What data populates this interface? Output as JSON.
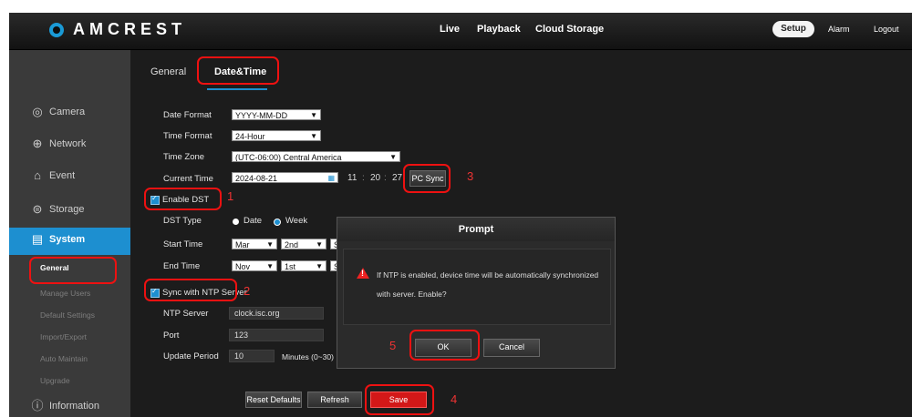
{
  "brand": {
    "name": "AMCREST"
  },
  "topnav": {
    "live": "Live",
    "playback": "Playback",
    "cloud_storage": "Cloud Storage",
    "setup": "Setup",
    "alarm": "Alarm",
    "logout": "Logout"
  },
  "sidebar": {
    "items": [
      {
        "label": "Camera",
        "icon": "camera-icon"
      },
      {
        "label": "Network",
        "icon": "network-icon"
      },
      {
        "label": "Event",
        "icon": "event-icon"
      },
      {
        "label": "Storage",
        "icon": "storage-icon"
      },
      {
        "label": "System",
        "icon": "system-icon"
      },
      {
        "label": "Information",
        "icon": "info-icon"
      }
    ],
    "system_sub": [
      "General",
      "Manage Users",
      "Default Settings",
      "Import/Export",
      "Auto Maintain",
      "Upgrade"
    ]
  },
  "tabs": {
    "general": "General",
    "datetime": "Date&Time"
  },
  "form": {
    "date_format_label": "Date Format",
    "date_format_value": "YYYY-MM-DD",
    "time_format_label": "Time Format",
    "time_format_value": "24-Hour",
    "time_zone_label": "Time Zone",
    "time_zone_value": "(UTC-06:00) Central America",
    "current_time_label": "Current Time",
    "current_date": "2024-08-21",
    "hour": "11",
    "minute": "20",
    "second": "27",
    "time_sep": ":",
    "pc_sync": "PC Sync",
    "enable_dst": "Enable DST",
    "dst_type_label": "DST Type",
    "dst_date": "Date",
    "dst_week": "Week",
    "start_time_label": "Start Time",
    "start_month": "Mar",
    "start_week": "2nd",
    "start_day": "S",
    "end_time_label": "End Time",
    "end_month": "Nov",
    "end_week": "1st",
    "end_day": "S",
    "sync_ntp": "Sync with NTP Server",
    "ntp_server_label": "NTP Server",
    "ntp_server_value": "clock.isc.org",
    "port_label": "Port",
    "port_value": "123",
    "update_period_label": "Update Period",
    "update_period_value": "10",
    "update_period_unit": "Minutes (0~30)"
  },
  "buttons": {
    "reset": "Reset Defaults",
    "refresh": "Refresh",
    "save": "Save"
  },
  "dialog": {
    "title": "Prompt",
    "message": "If NTP is enabled, device time will be automatically synchronized with server. Enable?",
    "ok": "OK",
    "cancel": "Cancel"
  },
  "annotations": [
    "1",
    "2",
    "3",
    "4",
    "5"
  ],
  "colors": {
    "accent": "#1d8fd0",
    "highlight": "#e11111"
  }
}
